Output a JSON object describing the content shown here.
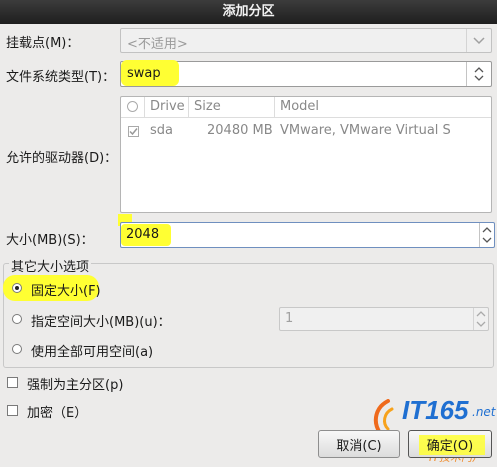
{
  "window": {
    "title": "添加分区"
  },
  "mount_point": {
    "label": "挂载点(M)：",
    "value": "<不适用>"
  },
  "fs_type": {
    "label": "文件系统类型(T)：",
    "value": "swap"
  },
  "drives": {
    "label": "允许的驱动器(D)：",
    "columns": [
      "Drive",
      "Size",
      "Model"
    ],
    "rows": [
      {
        "checked": true,
        "drive": "sda",
        "size": "20480 MB",
        "model": "VMware, VMware Virtual S"
      }
    ]
  },
  "size": {
    "label": "大小(MB)(S)：",
    "value": "2048"
  },
  "options": {
    "group_label": "其它大小选项",
    "fixed": {
      "label": "固定大小(F)",
      "selected": true
    },
    "fill_up_to": {
      "label": "指定空间大小(MB)(u)：",
      "value": "1",
      "selected": false
    },
    "fill_all": {
      "label": "使用全部可用空间(a)",
      "selected": false
    }
  },
  "force_primary": {
    "label": "强制为主分区(p)",
    "checked": false
  },
  "encrypt": {
    "label": "加密（E）",
    "checked": false
  },
  "buttons": {
    "cancel": "取消(C)",
    "ok": "确定(O)"
  },
  "watermark": {
    "text1": "IT165",
    "text2": ".net",
    "text3": "IT技术门户"
  },
  "colors": {
    "highlight": "#ffff33",
    "titlebar": "#2a2a2a",
    "background": "#ecebea"
  }
}
